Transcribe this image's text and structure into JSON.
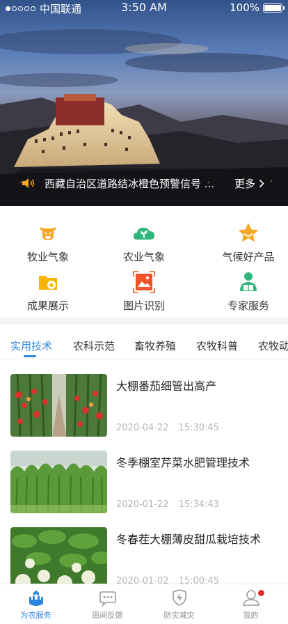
{
  "status_bar": {
    "carrier": "中国联通",
    "time": "3:50 AM",
    "battery": "100%"
  },
  "notice": {
    "text": "西藏自治区道路结冰橙色预警信号 ...",
    "more": "更多"
  },
  "services": [
    {
      "label": "牧业气象",
      "icon": "cow-icon",
      "color": "#f5a623"
    },
    {
      "label": "农业气象",
      "icon": "sprout-cloud-icon",
      "color": "#2fb67a"
    },
    {
      "label": "气候好产品",
      "icon": "star-icon",
      "color": "#f5a623"
    },
    {
      "label": "成果展示",
      "icon": "folder-star-icon",
      "color": "#f7b500"
    },
    {
      "label": "图片识别",
      "icon": "image-scan-icon",
      "color": "#f0542d"
    },
    {
      "label": "专家服务",
      "icon": "expert-icon",
      "color": "#2fb67a"
    }
  ],
  "tabs": [
    "实用技术",
    "农科示范",
    "畜牧养殖",
    "农牧科普",
    "农牧动态"
  ],
  "active_tab": "实用技术",
  "articles": [
    {
      "title": "大棚番茄细管出高产",
      "date": "2020-04-22",
      "time": "15:30:45",
      "thumb": "tomato-greenhouse"
    },
    {
      "title": "冬季棚室芹菜水肥管理技术",
      "date": "2020-01-22",
      "time": "15:34:43",
      "thumb": "celery-greenhouse"
    },
    {
      "title": "冬春茬大棚薄皮甜瓜栽培技术",
      "date": "2020-01-02",
      "time": "15:00:45",
      "thumb": "melon-greenhouse"
    }
  ],
  "bottom_nav": [
    {
      "label": "为农服务",
      "icon": "hand-plant-icon",
      "active": true
    },
    {
      "label": "田间反馈",
      "icon": "chat-bubble-icon",
      "active": false
    },
    {
      "label": "防灾减灾",
      "icon": "shield-bolt-icon",
      "active": false
    },
    {
      "label": "我的",
      "icon": "user-icon",
      "active": false,
      "badge": true
    }
  ],
  "colors": {
    "accent": "#2e86de",
    "badge": "#e52a2a"
  }
}
